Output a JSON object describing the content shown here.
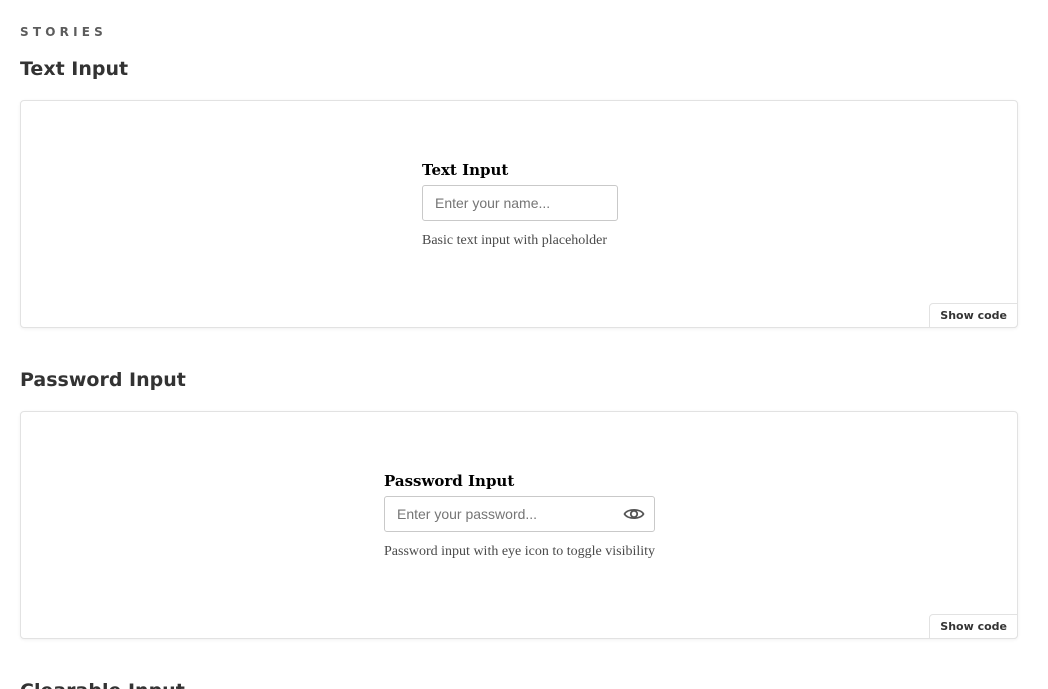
{
  "header": {
    "section_label": "STORIES"
  },
  "stories": [
    {
      "title": "Text Input",
      "field_label": "Text Input",
      "placeholder": "Enter your name...",
      "help_text": "Basic text input with placeholder",
      "show_code_label": "Show code"
    },
    {
      "title": "Password Input",
      "field_label": "Password Input",
      "placeholder": "Enter your password...",
      "help_text": "Password input with eye icon to toggle visibility",
      "show_code_label": "Show code",
      "icon": "eye-icon"
    },
    {
      "title": "Clearable Input"
    }
  ],
  "colors": {
    "border": "#e2e2e2",
    "input_border": "#c9c9c9",
    "heading": "#333333",
    "label_muted": "#5c5c5c"
  }
}
